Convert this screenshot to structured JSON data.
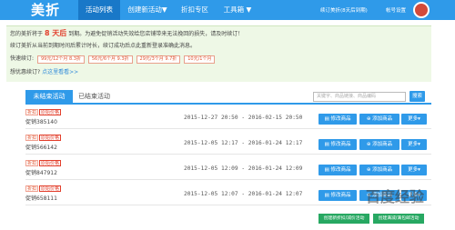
{
  "topbar": {
    "logo": "美折",
    "nav": [
      "活动列表",
      "创建新活动▼",
      "折扣专区",
      "工具箱 ▼"
    ],
    "renew": "续订美折(8天后到期)",
    "account": "帐号设置"
  },
  "notice": {
    "line1_pre": "您的美折将于",
    "line1_days": "8 天后",
    "line1_post": "到期。为避免促销活动失效给您店铺带来无法挽回的损失，请及时续订！",
    "line2": "续订美折从当前到期时间后累计时长，续订成功后点此重新登录准确此消息。",
    "quick_label": "快速续订:",
    "options": [
      "99元/12个月 8.3折",
      "56元/6个月 9.3折",
      "29元/3个月 9.7折",
      "10元/1个月"
    ],
    "cheaper_q": "想优惠续订?",
    "cheaper_link": "点这里看看>>"
  },
  "tabs": {
    "active": "未结束活动",
    "ended": "已结束活动"
  },
  "search": {
    "placeholder": "关键字、商品链接、商品编码",
    "button": "搜索"
  },
  "tags": {
    "discount": "折扣",
    "original": "原始价格"
  },
  "rows": [
    {
      "name": "促销385140",
      "time": "2015-12-27 20:50 - 2016-02-15 20:50"
    },
    {
      "name": "促销566142",
      "time": "2015-12-05 12:17 - 2016-01-24 12:17"
    },
    {
      "name": "促销847912",
      "time": "2015-12-05 12:09 - 2016-01-24 12:09"
    },
    {
      "name": "促销658111",
      "time": "2015-12-05 12:07 - 2016-01-24 12:07"
    }
  ],
  "row_buttons": {
    "edit": "修改商品",
    "add": "添加商品",
    "more": "更多▾"
  },
  "bottom_buttons": [
    "创建新折扣/减价活动",
    "创建满减/满包邮活动"
  ],
  "watermark": "百度经验"
}
